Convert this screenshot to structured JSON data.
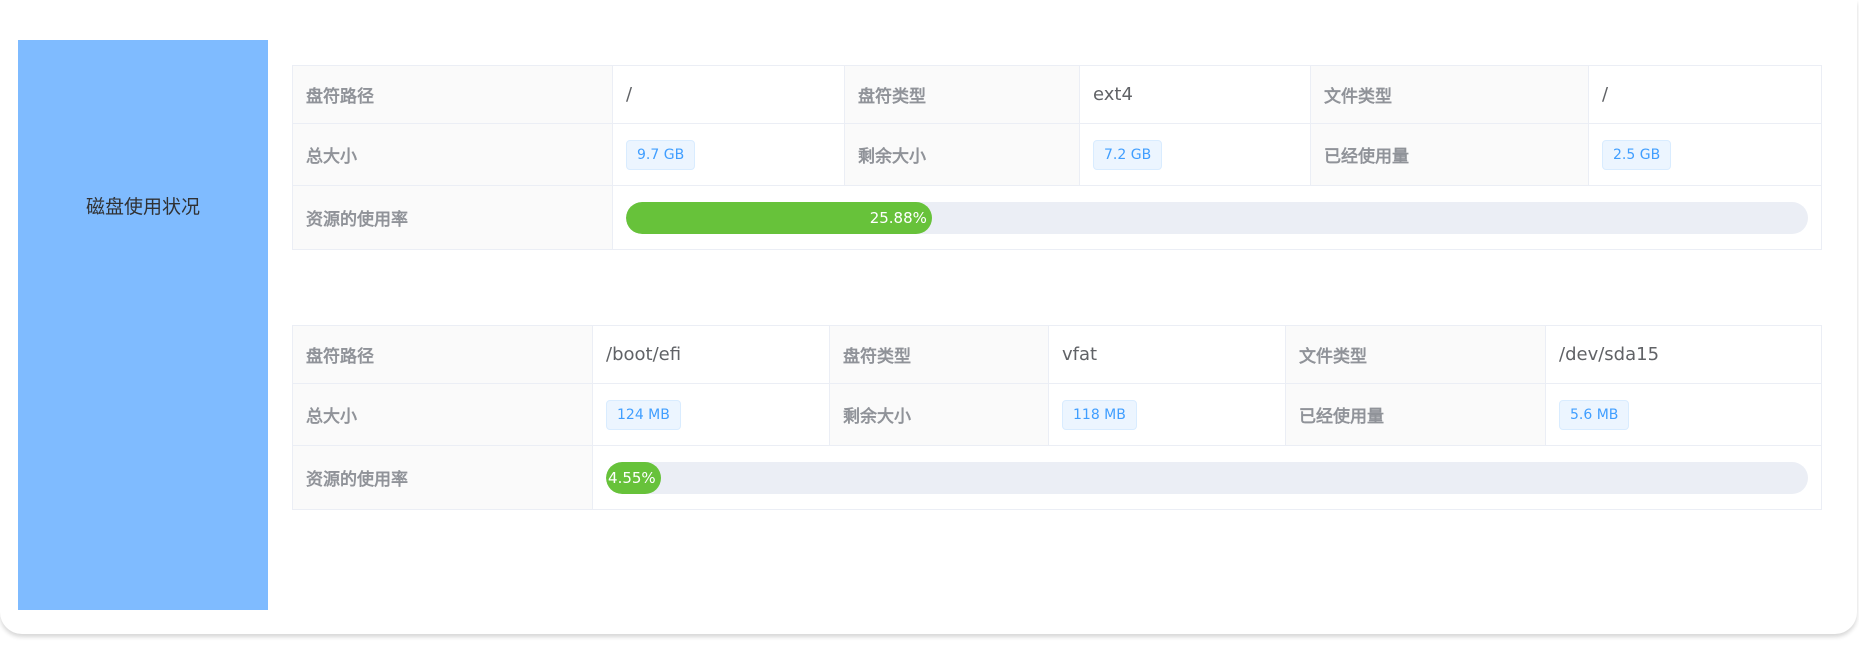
{
  "section_title": "磁盘使用状况",
  "disks": [
    {
      "path_label": "盘符路径",
      "path": "/",
      "drive_type_label": "盘符类型",
      "drive_type": "ext4",
      "file_type_label": "文件类型",
      "file_type": "/",
      "total_label": "总大小",
      "total": "9.7 GB",
      "free_label": "剩余大小",
      "free": "7.2 GB",
      "used_label": "已经使用量",
      "used": "2.5 GB",
      "usage_label": "资源的使用率",
      "usage_text": "25.88%",
      "usage_percent": 25.88
    },
    {
      "path_label": "盘符路径",
      "path": "/boot/efi",
      "drive_type_label": "盘符类型",
      "drive_type": "vfat",
      "file_type_label": "文件类型",
      "file_type": "/dev/sda15",
      "total_label": "总大小",
      "total": "124 MB",
      "free_label": "剩余大小",
      "free": "118 MB",
      "used_label": "已经使用量",
      "used": "5.6 MB",
      "usage_label": "资源的使用率",
      "usage_text": "4.55%",
      "usage_percent": 4.55
    }
  ],
  "colors": {
    "sidebar": "#7fbbff",
    "progress_fill": "#67c23a",
    "progress_track": "#ebeef5",
    "tag_text": "#409eff"
  }
}
